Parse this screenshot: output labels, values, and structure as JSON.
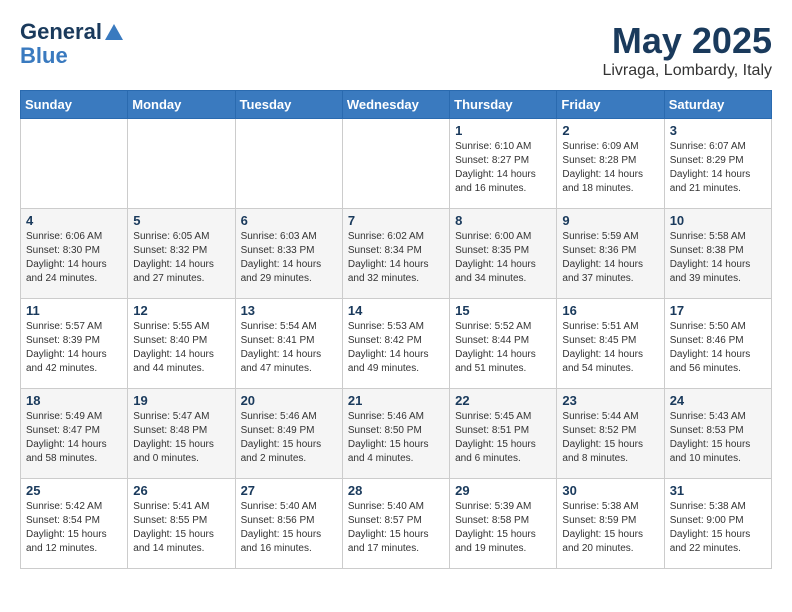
{
  "header": {
    "logo_line1": "General",
    "logo_line2": "Blue",
    "month": "May 2025",
    "location": "Livraga, Lombardy, Italy"
  },
  "weekdays": [
    "Sunday",
    "Monday",
    "Tuesday",
    "Wednesday",
    "Thursday",
    "Friday",
    "Saturday"
  ],
  "weeks": [
    [
      {
        "day": "",
        "info": ""
      },
      {
        "day": "",
        "info": ""
      },
      {
        "day": "",
        "info": ""
      },
      {
        "day": "",
        "info": ""
      },
      {
        "day": "1",
        "info": "Sunrise: 6:10 AM\nSunset: 8:27 PM\nDaylight: 14 hours\nand 16 minutes."
      },
      {
        "day": "2",
        "info": "Sunrise: 6:09 AM\nSunset: 8:28 PM\nDaylight: 14 hours\nand 18 minutes."
      },
      {
        "day": "3",
        "info": "Sunrise: 6:07 AM\nSunset: 8:29 PM\nDaylight: 14 hours\nand 21 minutes."
      }
    ],
    [
      {
        "day": "4",
        "info": "Sunrise: 6:06 AM\nSunset: 8:30 PM\nDaylight: 14 hours\nand 24 minutes."
      },
      {
        "day": "5",
        "info": "Sunrise: 6:05 AM\nSunset: 8:32 PM\nDaylight: 14 hours\nand 27 minutes."
      },
      {
        "day": "6",
        "info": "Sunrise: 6:03 AM\nSunset: 8:33 PM\nDaylight: 14 hours\nand 29 minutes."
      },
      {
        "day": "7",
        "info": "Sunrise: 6:02 AM\nSunset: 8:34 PM\nDaylight: 14 hours\nand 32 minutes."
      },
      {
        "day": "8",
        "info": "Sunrise: 6:00 AM\nSunset: 8:35 PM\nDaylight: 14 hours\nand 34 minutes."
      },
      {
        "day": "9",
        "info": "Sunrise: 5:59 AM\nSunset: 8:36 PM\nDaylight: 14 hours\nand 37 minutes."
      },
      {
        "day": "10",
        "info": "Sunrise: 5:58 AM\nSunset: 8:38 PM\nDaylight: 14 hours\nand 39 minutes."
      }
    ],
    [
      {
        "day": "11",
        "info": "Sunrise: 5:57 AM\nSunset: 8:39 PM\nDaylight: 14 hours\nand 42 minutes."
      },
      {
        "day": "12",
        "info": "Sunrise: 5:55 AM\nSunset: 8:40 PM\nDaylight: 14 hours\nand 44 minutes."
      },
      {
        "day": "13",
        "info": "Sunrise: 5:54 AM\nSunset: 8:41 PM\nDaylight: 14 hours\nand 47 minutes."
      },
      {
        "day": "14",
        "info": "Sunrise: 5:53 AM\nSunset: 8:42 PM\nDaylight: 14 hours\nand 49 minutes."
      },
      {
        "day": "15",
        "info": "Sunrise: 5:52 AM\nSunset: 8:44 PM\nDaylight: 14 hours\nand 51 minutes."
      },
      {
        "day": "16",
        "info": "Sunrise: 5:51 AM\nSunset: 8:45 PM\nDaylight: 14 hours\nand 54 minutes."
      },
      {
        "day": "17",
        "info": "Sunrise: 5:50 AM\nSunset: 8:46 PM\nDaylight: 14 hours\nand 56 minutes."
      }
    ],
    [
      {
        "day": "18",
        "info": "Sunrise: 5:49 AM\nSunset: 8:47 PM\nDaylight: 14 hours\nand 58 minutes."
      },
      {
        "day": "19",
        "info": "Sunrise: 5:47 AM\nSunset: 8:48 PM\nDaylight: 15 hours\nand 0 minutes."
      },
      {
        "day": "20",
        "info": "Sunrise: 5:46 AM\nSunset: 8:49 PM\nDaylight: 15 hours\nand 2 minutes."
      },
      {
        "day": "21",
        "info": "Sunrise: 5:46 AM\nSunset: 8:50 PM\nDaylight: 15 hours\nand 4 minutes."
      },
      {
        "day": "22",
        "info": "Sunrise: 5:45 AM\nSunset: 8:51 PM\nDaylight: 15 hours\nand 6 minutes."
      },
      {
        "day": "23",
        "info": "Sunrise: 5:44 AM\nSunset: 8:52 PM\nDaylight: 15 hours\nand 8 minutes."
      },
      {
        "day": "24",
        "info": "Sunrise: 5:43 AM\nSunset: 8:53 PM\nDaylight: 15 hours\nand 10 minutes."
      }
    ],
    [
      {
        "day": "25",
        "info": "Sunrise: 5:42 AM\nSunset: 8:54 PM\nDaylight: 15 hours\nand 12 minutes."
      },
      {
        "day": "26",
        "info": "Sunrise: 5:41 AM\nSunset: 8:55 PM\nDaylight: 15 hours\nand 14 minutes."
      },
      {
        "day": "27",
        "info": "Sunrise: 5:40 AM\nSunset: 8:56 PM\nDaylight: 15 hours\nand 16 minutes."
      },
      {
        "day": "28",
        "info": "Sunrise: 5:40 AM\nSunset: 8:57 PM\nDaylight: 15 hours\nand 17 minutes."
      },
      {
        "day": "29",
        "info": "Sunrise: 5:39 AM\nSunset: 8:58 PM\nDaylight: 15 hours\nand 19 minutes."
      },
      {
        "day": "30",
        "info": "Sunrise: 5:38 AM\nSunset: 8:59 PM\nDaylight: 15 hours\nand 20 minutes."
      },
      {
        "day": "31",
        "info": "Sunrise: 5:38 AM\nSunset: 9:00 PM\nDaylight: 15 hours\nand 22 minutes."
      }
    ]
  ]
}
